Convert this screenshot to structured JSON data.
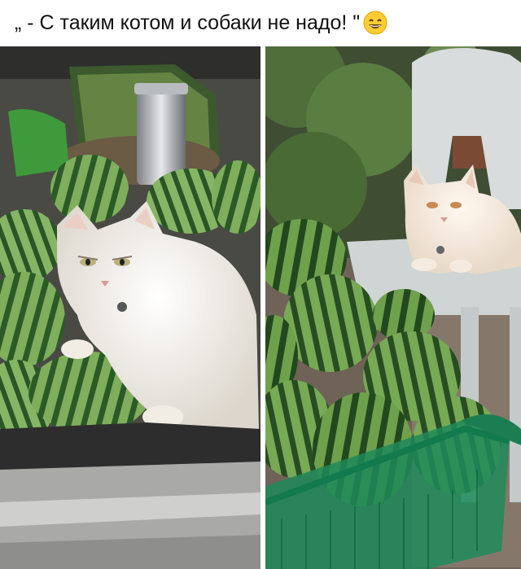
{
  "caption": {
    "text": "„ - С таким котом и собаки не надо! \"",
    "emoji": "grinning-face-with-smiling-eyes-icon"
  },
  "photos": [
    {
      "subject": "white-cat-on-watermelons-in-car-trunk"
    },
    {
      "subject": "white-cat-on-plastic-chair-above-watermelon-basket"
    }
  ],
  "colors": {
    "watermelon_dark": "#2f5a2a",
    "watermelon_light": "#8db86a",
    "cat_fur": "#f4f1ea",
    "basket": "#1f8a5a",
    "chair": "#d8dcdc"
  }
}
